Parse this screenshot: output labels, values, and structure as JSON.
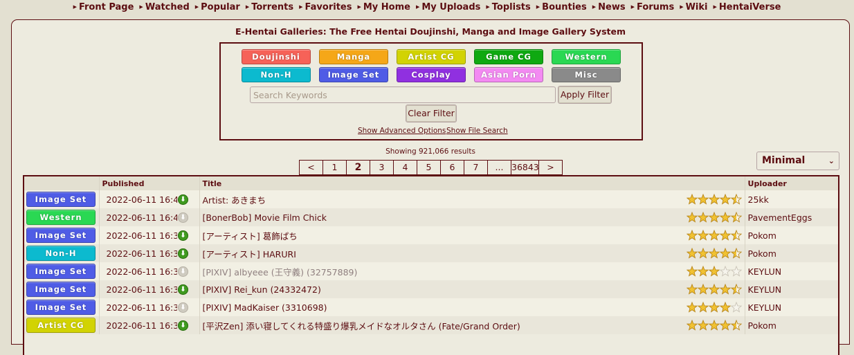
{
  "nav": [
    "Front Page",
    "Watched",
    "Popular",
    "Torrents",
    "Favorites",
    "My Home",
    "My Uploads",
    "Toplists",
    "Bounties",
    "News",
    "Forums",
    "Wiki",
    "HentaiVerse"
  ],
  "site_title": "E-Hentai Galleries: The Free Hentai Doujinshi, Manga and Image Gallery System",
  "categories": [
    {
      "label": "Doujinshi",
      "color": "#f66258"
    },
    {
      "label": "Manga",
      "color": "#f5a718"
    },
    {
      "label": "Artist CG",
      "color": "#d2d303"
    },
    {
      "label": "Game CG",
      "color": "#0fa911"
    },
    {
      "label": "Western",
      "color": "#2ad853"
    },
    {
      "label": "Non-H",
      "color": "#0cbacf"
    },
    {
      "label": "Image Set",
      "color": "#4f5ce6"
    },
    {
      "label": "Cosplay",
      "color": "#9030e0"
    },
    {
      "label": "Asian Porn",
      "color": "#f38af2"
    },
    {
      "label": "Misc",
      "color": "#8a8a8a"
    }
  ],
  "search": {
    "placeholder": "Search Keywords",
    "apply_label": "Apply Filter",
    "clear_label": "Clear Filter",
    "advanced_label": "Show Advanced Options",
    "file_search_label": "Show File Search"
  },
  "results_text": "Showing 921,066 results",
  "pager": [
    "<",
    "1",
    "2",
    "3",
    "4",
    "5",
    "6",
    "7",
    "...",
    "36843",
    ">"
  ],
  "current_page": "2",
  "display_mode": "Minimal",
  "table": {
    "headers": {
      "published": "Published",
      "title": "Title",
      "uploader": "Uploader"
    },
    "rows": [
      {
        "category": "Image Set",
        "published": "2022-06-11 16:42",
        "download": true,
        "title": "Artist: あきまち",
        "rating": 4.5,
        "uploader": "25kk"
      },
      {
        "category": "Western",
        "published": "2022-06-11 16:40",
        "download": false,
        "title": "[BonerBob] Movie Film Chick",
        "rating": 4.5,
        "uploader": "PavementEggs"
      },
      {
        "category": "Image Set",
        "published": "2022-06-11 16:39",
        "download": true,
        "title": "[アーティスト] 葛飾ぱち",
        "rating": 4.5,
        "uploader": "Pokom"
      },
      {
        "category": "Non-H",
        "published": "2022-06-11 16:35",
        "download": true,
        "title": "[アーティスト] HARURI",
        "rating": 4.5,
        "uploader": "Pokom"
      },
      {
        "category": "Image Set",
        "published": "2022-06-11 16:32",
        "download": false,
        "title": "[PIXIV] albyeee (王守義) (32757889)",
        "rating": 3,
        "uploader": "KEYLUN",
        "faded": true
      },
      {
        "category": "Image Set",
        "published": "2022-06-11 16:31",
        "download": true,
        "title": "[PIXIV] Rei_kun (24332472)",
        "rating": 4.5,
        "uploader": "KEYLUN"
      },
      {
        "category": "Image Set",
        "published": "2022-06-11 16:31",
        "download": false,
        "title": "[PIXIV] MadKaiser (3310698)",
        "rating": 4,
        "uploader": "KEYLUN"
      },
      {
        "category": "Artist CG",
        "published": "2022-06-11 16:31",
        "download": true,
        "title": "[平沢Zen] 添い寝してくれる特盛り爆乳メイドなオルタさん (Fate/Grand Order)",
        "rating": 4.5,
        "uploader": "Pokom"
      }
    ]
  }
}
